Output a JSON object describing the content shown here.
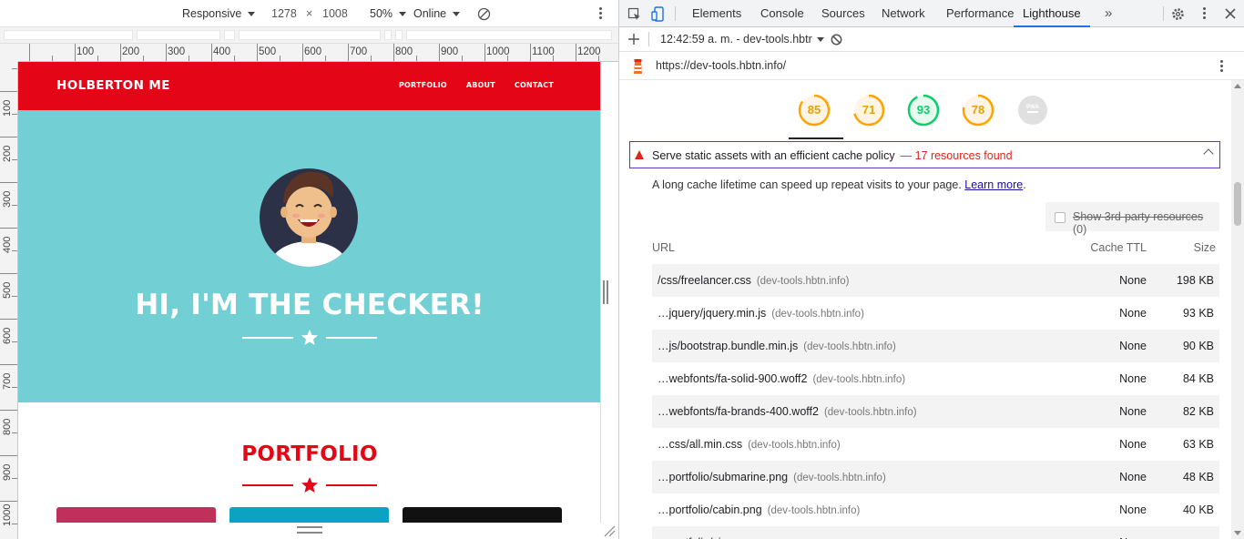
{
  "device_toolbar": {
    "device": "Responsive",
    "width": "1278",
    "times": "×",
    "height": "1008",
    "zoom": "50%",
    "throttle": "Online"
  },
  "ruler": {
    "h_labels": [
      "100",
      "200",
      "300",
      "400",
      "500",
      "600",
      "700",
      "800",
      "900",
      "1000",
      "1100",
      "1200"
    ],
    "v_labels": [
      "100",
      "200",
      "300",
      "400",
      "500",
      "600",
      "700",
      "800",
      "900",
      "1000"
    ]
  },
  "site": {
    "brand": "HOLBERTON ME",
    "nav": [
      "PORTFOLIO",
      "ABOUT",
      "CONTACT"
    ],
    "hero_title": "HI, I'M THE CHECKER!",
    "section_title": "PORTFOLIO",
    "colors": {
      "red": "#e40516",
      "teal": "#72cfd4"
    },
    "card_colors": [
      "#c0305a",
      "#0aa3c2",
      "#111111"
    ]
  },
  "devtools": {
    "tabs": [
      "Elements",
      "Console",
      "Sources",
      "Network",
      "Performance",
      "Lighthouse"
    ],
    "active_tab": "Lighthouse",
    "report_selector": "12:42:59 a. m. - dev-tools.hbtr",
    "url": "https://dev-tools.hbtn.info/",
    "gauges": [
      {
        "value": "85",
        "color": "#ffa400"
      },
      {
        "value": "71",
        "color": "#ffa400"
      },
      {
        "value": "93",
        "color": "#0cce6b"
      },
      {
        "value": "78",
        "color": "#ffa400"
      },
      {
        "value": "PWA",
        "color": "#c4c4c4"
      }
    ],
    "audit": {
      "title": "Serve static assets with an efficient cache policy",
      "dash": "—",
      "found": "17 resources found",
      "description": "A long cache lifetime can speed up repeat visits to your page.",
      "learn_more": "Learn more",
      "period": ".",
      "third_party_label": "Show 3rd-party resources",
      "third_party_count": "(0)",
      "columns": {
        "url": "URL",
        "ttl": "Cache TTL",
        "size": "Size"
      },
      "rows": [
        {
          "url": "/css/freelancer.css",
          "host": "(dev-tools.hbtn.info)",
          "ttl": "None",
          "size": "198 KB"
        },
        {
          "url": "…jquery/jquery.min.js",
          "host": "(dev-tools.hbtn.info)",
          "ttl": "None",
          "size": "93 KB"
        },
        {
          "url": "…js/bootstrap.bundle.min.js",
          "host": "(dev-tools.hbtn.info)",
          "ttl": "None",
          "size": "90 KB"
        },
        {
          "url": "…webfonts/fa-solid-900.woff2",
          "host": "(dev-tools.hbtn.info)",
          "ttl": "None",
          "size": "84 KB"
        },
        {
          "url": "…webfonts/fa-brands-400.woff2",
          "host": "(dev-tools.hbtn.info)",
          "ttl": "None",
          "size": "82 KB"
        },
        {
          "url": "…css/all.min.css",
          "host": "(dev-tools.hbtn.info)",
          "ttl": "None",
          "size": "63 KB"
        },
        {
          "url": "…portfolio/submarine.png",
          "host": "(dev-tools.hbtn.info)",
          "ttl": "None",
          "size": "48 KB"
        },
        {
          "url": "…portfolio/cabin.png",
          "host": "(dev-tools.hbtn.info)",
          "ttl": "None",
          "size": "40 KB"
        },
        {
          "url": "…portfolio/circus.png",
          "host": "",
          "ttl": "None",
          "size": ""
        }
      ]
    }
  }
}
